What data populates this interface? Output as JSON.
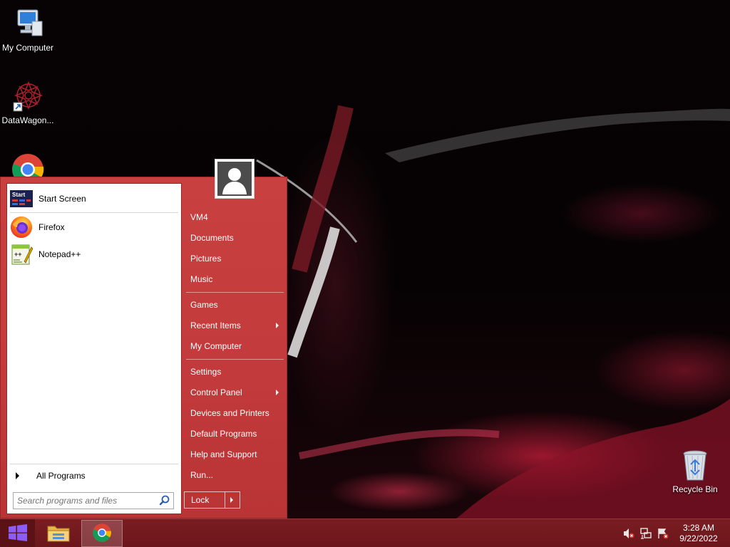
{
  "desktop": {
    "icons": [
      {
        "label": "My Computer",
        "icon": "computer-icon"
      },
      {
        "label": "DataWagon...",
        "icon": "datawagon-shortcut-icon"
      },
      {
        "label": "",
        "icon": "chrome-icon"
      },
      {
        "label": "Recycle Bin",
        "icon": "recycle-bin-icon"
      }
    ]
  },
  "start_menu": {
    "pinned": [
      {
        "label": "Start Screen",
        "icon": "start-screen-icon"
      },
      {
        "label": "Firefox",
        "icon": "firefox-icon"
      },
      {
        "label": "Notepad++",
        "icon": "notepad-plus-plus-icon"
      }
    ],
    "all_programs": "All Programs",
    "search_placeholder": "Search programs and files",
    "user_icon": "user-avatar-icon",
    "right_items": [
      {
        "label": "VM4",
        "submenu": false
      },
      {
        "label": "Documents",
        "submenu": false
      },
      {
        "label": "Pictures",
        "submenu": false
      },
      {
        "label": "Music",
        "submenu": false
      },
      {
        "label": "Games",
        "submenu": false
      },
      {
        "label": "Recent Items",
        "submenu": true
      },
      {
        "label": "My Computer",
        "submenu": false
      },
      {
        "label": "Settings",
        "submenu": false
      },
      {
        "label": "Control Panel",
        "submenu": true
      },
      {
        "label": "Devices and Printers",
        "submenu": false
      },
      {
        "label": "Default Programs",
        "submenu": false
      },
      {
        "label": "Help and Support",
        "submenu": false
      },
      {
        "label": "Run...",
        "submenu": false
      }
    ],
    "lock_label": "Lock"
  },
  "taskbar": {
    "pinned": [
      {
        "name": "file-explorer",
        "icon": "folder-icon"
      },
      {
        "name": "chrome",
        "icon": "chrome-icon",
        "active": true
      }
    ],
    "tray": [
      "speaker-muted-icon",
      "network-icon",
      "action-center-icon"
    ],
    "clock": {
      "time": "3:28 AM",
      "date": "9/22/2022"
    }
  },
  "colors": {
    "accent": "#c23a3b",
    "taskbar": "#6e181d",
    "start_button": "#5b1217"
  }
}
